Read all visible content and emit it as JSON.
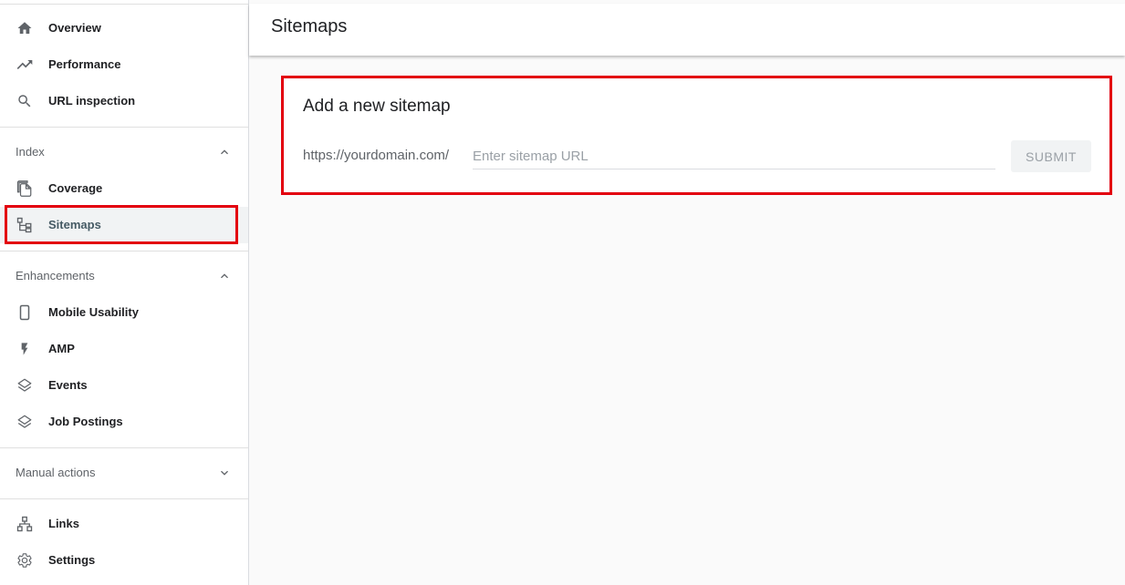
{
  "sidebar": {
    "top_items": [
      {
        "label": "Overview",
        "icon": "home-icon"
      },
      {
        "label": "Performance",
        "icon": "trending-up-icon"
      },
      {
        "label": "URL inspection",
        "icon": "search-icon"
      }
    ],
    "index_section": {
      "label": "Index",
      "expanded": true,
      "items": [
        {
          "label": "Coverage",
          "icon": "copy-pages-icon"
        },
        {
          "label": "Sitemaps",
          "icon": "sitemap-icon",
          "selected": true
        }
      ]
    },
    "enhancements_section": {
      "label": "Enhancements",
      "expanded": true,
      "items": [
        {
          "label": "Mobile Usability",
          "icon": "smartphone-icon"
        },
        {
          "label": "AMP",
          "icon": "lightning-bolt-icon"
        },
        {
          "label": "Events",
          "icon": "layers-icon"
        },
        {
          "label": "Job Postings",
          "icon": "layers-icon"
        }
      ]
    },
    "manual_actions_section": {
      "label": "Manual actions",
      "expanded": false
    },
    "bottom_items": [
      {
        "label": "Links",
        "icon": "link-network-icon"
      },
      {
        "label": "Settings",
        "icon": "gear-icon"
      }
    ]
  },
  "header": {
    "title": "Sitemaps"
  },
  "add_sitemap": {
    "title": "Add a new sitemap",
    "url_prefix": "https://yourdomain.com/",
    "input_value": "",
    "input_placeholder": "Enter sitemap URL",
    "submit_label": "SUBMIT"
  },
  "colors": {
    "highlight_outline": "#e3000f",
    "icon": "#5f6368",
    "selected_bg": "#f1f3f4"
  }
}
